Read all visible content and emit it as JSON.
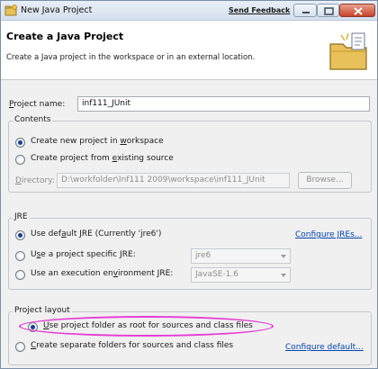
{
  "window": {
    "title": "New Java Project",
    "feedback_link": "Send Feedback"
  },
  "banner": {
    "title": "Create a Java Project",
    "description": "Create a Java project in the workspace or in an external location."
  },
  "project_name": {
    "label_first": "P",
    "label_rest": "roject name:",
    "value": "inf111_JUnit"
  },
  "contents": {
    "title": "Contents",
    "option_new_pre": "Create new project in ",
    "option_new_u": "w",
    "option_new_post": "orkspace",
    "option_existing_pre": "Create project from ",
    "option_existing_u": "e",
    "option_existing_post": "xisting source",
    "directory_label_first": "D",
    "directory_label_rest": "irectory:",
    "directory_value": "D:\\workfolder\\Inf111 2009\\workspace\\inf111_JUnit",
    "browse_label": "Browse..."
  },
  "jre": {
    "title": "JRE",
    "option_default_pre": "Use def",
    "option_default_u": "a",
    "option_default_post": "ult JRE (Currently 'jre6')",
    "configure_link": "Configure JREs...",
    "option_specific_pre": "U",
    "option_specific_u": "s",
    "option_specific_post": "e a project specific JRE:",
    "specific_value": "jre6",
    "option_env_pre": "Use an execution en",
    "option_env_u": "v",
    "option_env_post": "ironment JRE:",
    "env_value": "JavaSE-1.6"
  },
  "layout": {
    "title": "Project layout",
    "option_root_u": "U",
    "option_root_rest": "se project folder as root for sources and class files",
    "option_separate_u": "C",
    "option_separate_rest": "reate separate folders for sources and class files",
    "configure_link": "Configure default..."
  },
  "colors": {
    "highlight": "#e63ad6",
    "link": "#0645ad",
    "radio_selected": "#1b3f8e"
  }
}
